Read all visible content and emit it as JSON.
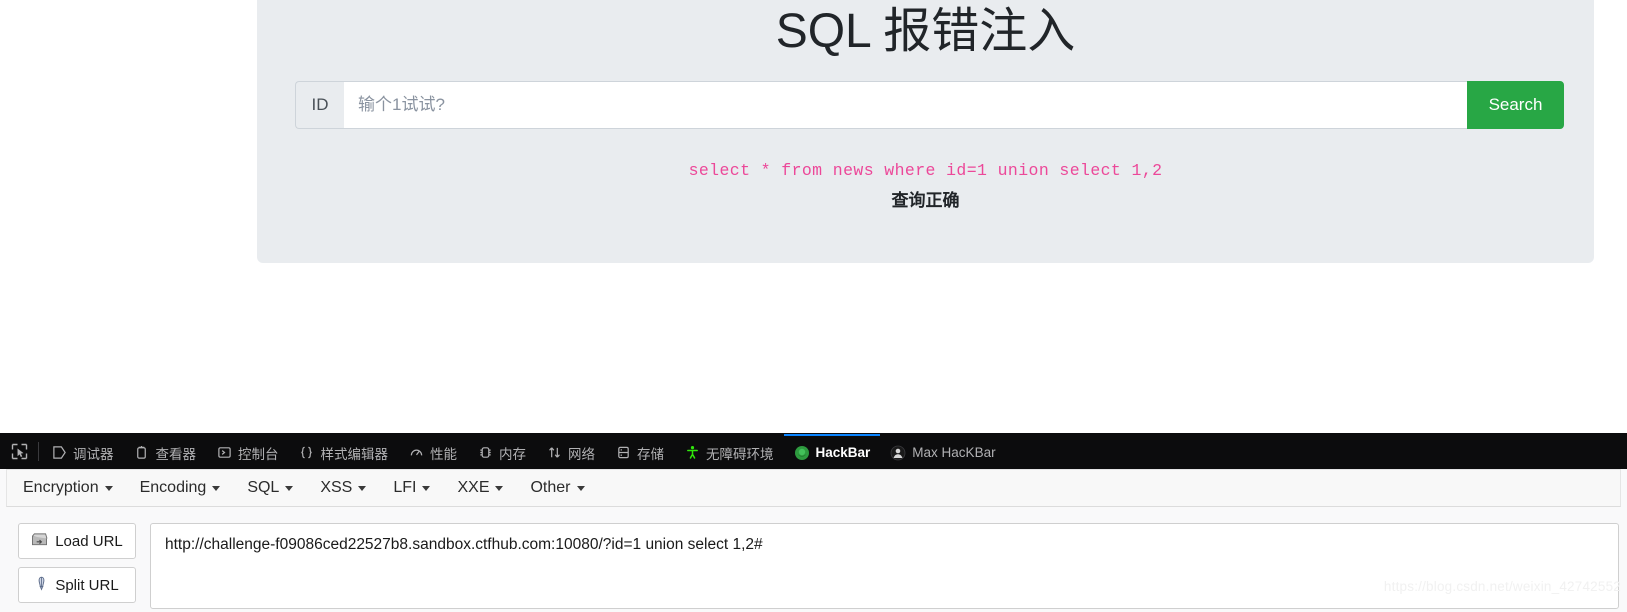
{
  "page": {
    "title": "SQL 报错注入",
    "input_group": {
      "prefix_label": "ID",
      "placeholder": "输个1试试?",
      "value": "",
      "search_label": "Search"
    },
    "result": {
      "query": "select * from news where id=1 union select 1,2",
      "status": "查询正确",
      "query_color": "#ec4899"
    }
  },
  "devtools": {
    "picker_icon": "element-picker-icon",
    "tabs": [
      {
        "label": "调试器",
        "icon": "debugger-icon",
        "active": false
      },
      {
        "label": "查看器",
        "icon": "inspector-icon",
        "active": false
      },
      {
        "label": "控制台",
        "icon": "console-icon",
        "active": false
      },
      {
        "label": "样式编辑器",
        "icon": "style-editor-icon",
        "active": false
      },
      {
        "label": "性能",
        "icon": "performance-icon",
        "active": false
      },
      {
        "label": "内存",
        "icon": "memory-icon",
        "active": false
      },
      {
        "label": "网络",
        "icon": "network-icon",
        "active": false
      },
      {
        "label": "存储",
        "icon": "storage-icon",
        "active": false
      },
      {
        "label": "无障碍环境",
        "icon": "accessibility-icon",
        "active": false
      },
      {
        "label": "HackBar",
        "icon": "hackbar-icon",
        "active": true
      },
      {
        "label": "Max HacKBar",
        "icon": "max-hackbar-icon",
        "active": false
      }
    ],
    "active_tab_accent": "#0a84ff"
  },
  "hackbar": {
    "menu": [
      {
        "label": "Encryption"
      },
      {
        "label": "Encoding"
      },
      {
        "label": "SQL"
      },
      {
        "label": "XSS"
      },
      {
        "label": "LFI"
      },
      {
        "label": "XXE"
      },
      {
        "label": "Other"
      }
    ],
    "buttons": [
      {
        "label": "Load URL",
        "icon": "load-url-icon"
      },
      {
        "label": "Split URL",
        "icon": "split-url-icon"
      }
    ],
    "url_value": "http://challenge-f09086ced22527b8.sandbox.ctfhub.com:10080/?id=1 union select 1,2#"
  },
  "watermark": {
    "text": "https://blog.csdn.net/weixin_42742552"
  }
}
